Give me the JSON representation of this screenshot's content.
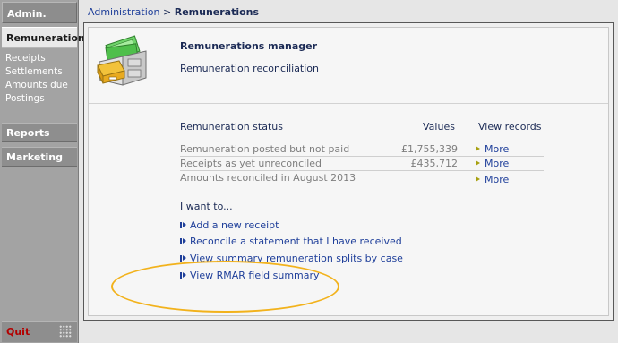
{
  "sidebar": {
    "admin": "Admin.",
    "remuneration": "Remuneration",
    "sub_items": [
      "Receipts",
      "Settlements",
      "Amounts due",
      "Postings"
    ],
    "reports": "Reports",
    "marketing": "Marketing",
    "quit": "Quit"
  },
  "breadcrumb": {
    "root": "Administration",
    "separator": ">",
    "current": "Remunerations"
  },
  "manager": {
    "title": "Remunerations manager",
    "subtitle": "Remuneration reconciliation",
    "icon": "filing-cabinet-money-icon"
  },
  "status": {
    "header_label": "Remuneration status",
    "header_values": "Values",
    "header_view": "View records",
    "rows": [
      {
        "label": "Remuneration posted but not paid",
        "value": "£1,755,339",
        "more": "More"
      },
      {
        "label": "Receipts as yet unreconciled",
        "value": "£435,712",
        "more": "More"
      },
      {
        "label": "Amounts reconciled in August 2013",
        "value": "",
        "more": "More"
      }
    ]
  },
  "actions": {
    "heading": "I want to...",
    "links": [
      "Add a new receipt",
      "Reconcile a statement that I have received",
      "View summary remuneration splits by case",
      "View RMAR field summary"
    ]
  },
  "colors": {
    "sidebar": "#a3a3a3",
    "highlight_ellipse": "#f2b21c",
    "link": "#1f3f9a",
    "quit": "#b30000"
  }
}
